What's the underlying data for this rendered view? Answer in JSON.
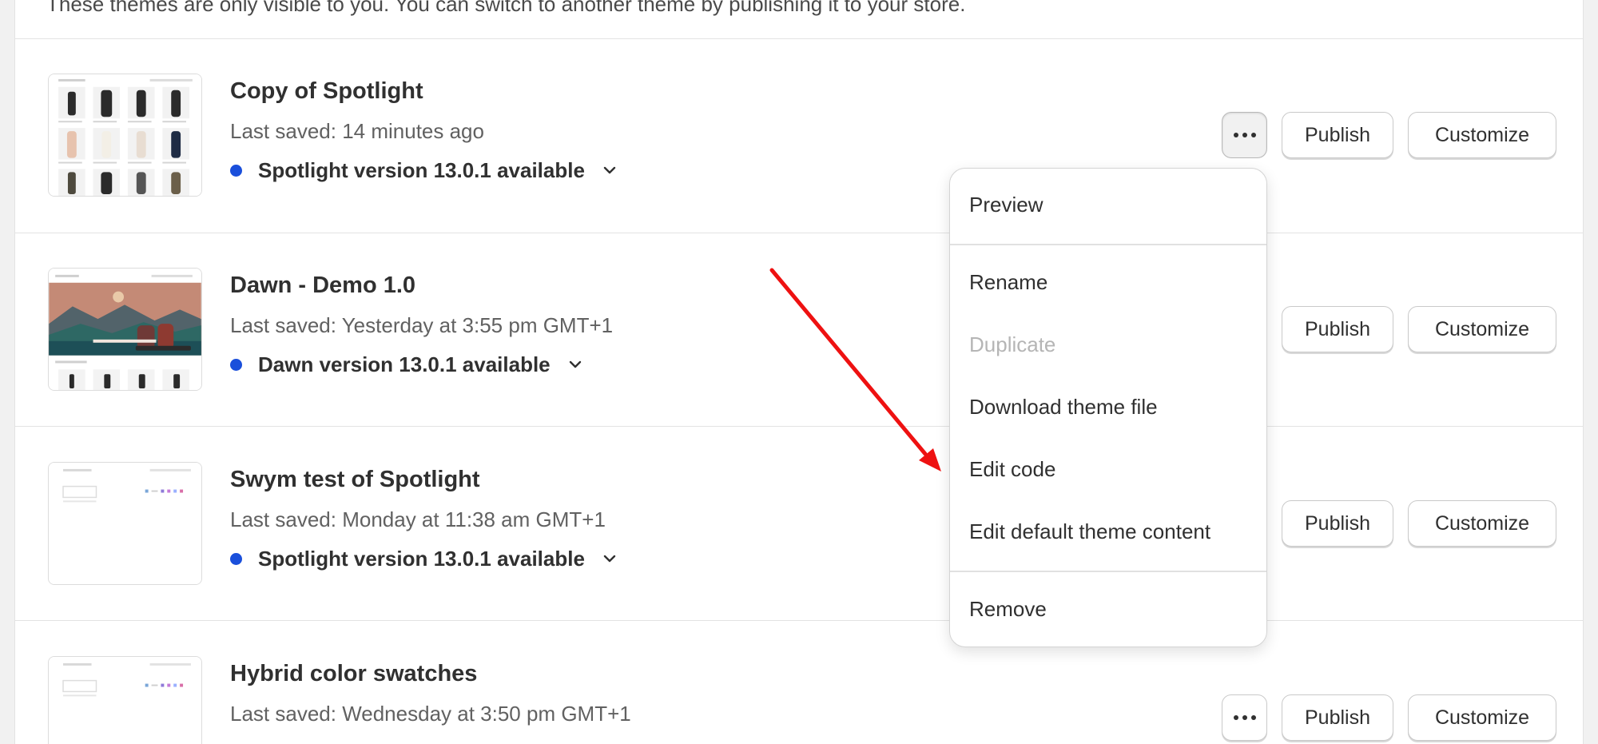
{
  "intro_text": "These themes are only visible to you. You can switch to another theme by publishing it to your store.",
  "themes": [
    {
      "name": "Copy of Spotlight",
      "last_saved": "Last saved: 14 minutes ago",
      "update": "Spotlight version 13.0.1 available"
    },
    {
      "name": "Dawn - Demo 1.0",
      "last_saved": "Last saved: Yesterday at 3:55 pm GMT+1",
      "update": "Dawn version 13.0.1 available"
    },
    {
      "name": "Swym test of Spotlight",
      "last_saved": "Last saved: Monday at 11:38 am GMT+1",
      "update": "Spotlight version 13.0.1 available"
    },
    {
      "name": "Hybrid color swatches",
      "last_saved": "Last saved: Wednesday at 3:50 pm GMT+1"
    }
  ],
  "buttons": {
    "publish": "Publish",
    "customize": "Customize"
  },
  "menu": {
    "items": [
      {
        "label": "Preview",
        "enabled": true
      },
      {
        "label": "Rename",
        "enabled": true
      },
      {
        "label": "Duplicate",
        "enabled": false
      },
      {
        "label": "Download theme file",
        "enabled": true
      },
      {
        "label": "Edit code",
        "enabled": true
      },
      {
        "label": "Edit default theme content",
        "enabled": true
      },
      {
        "label": "Remove",
        "enabled": true
      }
    ]
  },
  "colors": {
    "update_dot": "#1a4fdb",
    "annotation_arrow": "#ee1111"
  },
  "icons": {
    "update": "blue-dot-icon",
    "expand": "chevron-down-icon",
    "more": "ellipsis-icon"
  }
}
